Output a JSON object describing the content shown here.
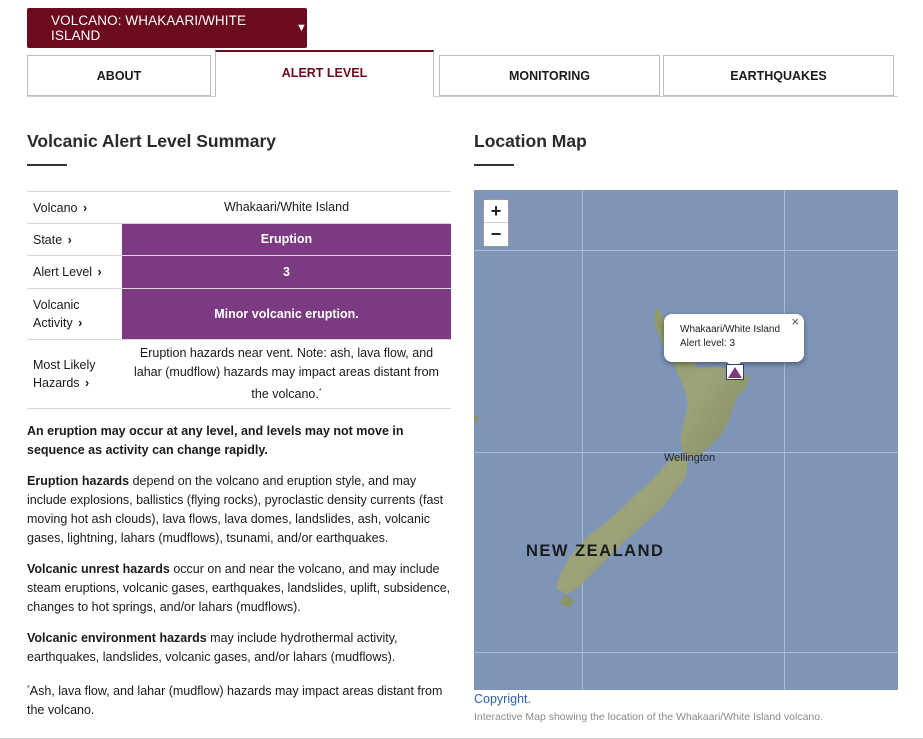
{
  "volcano_select": {
    "label": "VOLCANO: WHAKAARI/WHITE ISLAND",
    "caret": "▼"
  },
  "tabs": [
    {
      "label": "ABOUT"
    },
    {
      "label": "ALERT LEVEL"
    },
    {
      "label": "MONITORING"
    },
    {
      "label": "EARTHQUAKES"
    }
  ],
  "summary": {
    "title": "Volcanic Alert Level Summary",
    "rows": [
      {
        "label": "Volcano",
        "value": "Whakaari/White Island"
      },
      {
        "label": "State",
        "value": "Eruption"
      },
      {
        "label": "Alert Level",
        "value": "3"
      },
      {
        "label_line1": "Volcanic",
        "label_line2": "Activity",
        "value": "Minor volcanic eruption."
      },
      {
        "label_line1": "Most Likely",
        "label_line2": "Hazards",
        "value": "Eruption hazards near vent. Note: ash, lava flow, and lahar (mudflow) hazards may impact areas distant from the volcano.",
        "footnote_mark": "*"
      }
    ],
    "chevron": "›",
    "highlight_color": "#7b3a82"
  },
  "notes": {
    "warning": "An eruption may occur at any level, and levels may not move in sequence as activity can change rapidly.",
    "eruption_title": "Eruption hazards",
    "eruption_text": " depend on the volcano and eruption style, and may include explosions, ballistics (flying rocks), pyroclastic density currents (fast moving hot ash clouds), lava flows, lava domes, landslides, ash, volcanic gases, lightning, lahars (mudflows), tsunami, and/or earthquakes.",
    "unrest_title": "Volcanic unrest hazards",
    "unrest_text": " occur on and near the volcano, and may include steam eruptions, volcanic gases, earthquakes, landslides, uplift, subsidence, changes to hot springs, and/or lahars (mudflows).",
    "environment_title": "Volcanic environment hazards",
    "environment_text": " may include hydrothermal activity, earthquakes, landslides, volcanic gases, and/or lahars (mudflows).",
    "footnote_mark": "*",
    "footnote_text": "Ash, lava flow, and lahar (mudflow) hazards may impact areas distant from the volcano."
  },
  "map": {
    "title": "Location Map",
    "zoom_in": "+",
    "zoom_out": "−",
    "popup_line1": "Whakaari/White Island",
    "popup_line2": "Alert level: 3",
    "popup_close": "×",
    "city_label": "Wellington",
    "country_label": "NEW ZEALAND",
    "copyright": "Copyright.",
    "caption": "Interactive Map showing the location of the Whakaari/White Island volcano.",
    "ocean_color": "#7e95b8",
    "marker_color": "#7b3a82"
  },
  "colors": {
    "brand": "#6d0b1e"
  }
}
